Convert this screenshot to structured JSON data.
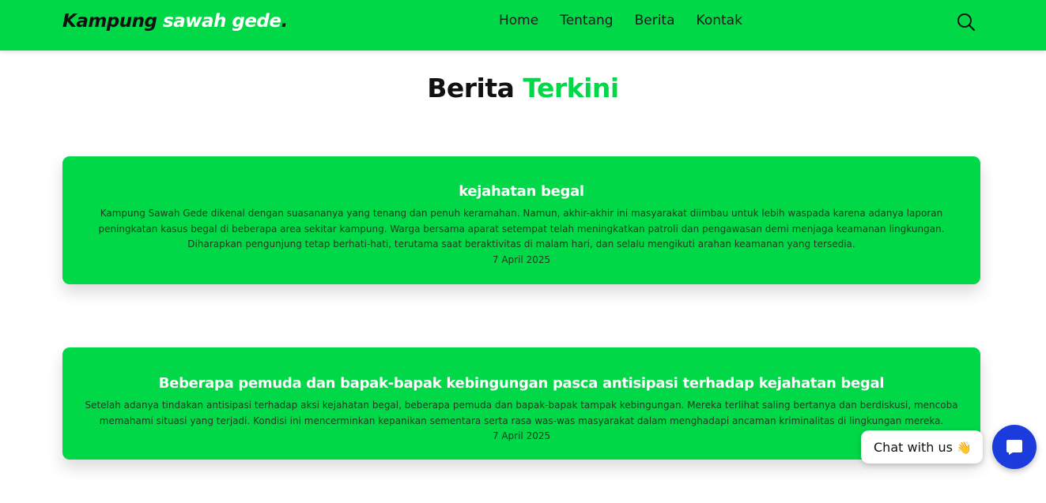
{
  "header": {
    "logo_part1": "Kampung ",
    "logo_part2": "sawah gede",
    "logo_part3": ".",
    "nav": [
      "Home",
      "Tentang",
      "Berita",
      "Kontak"
    ],
    "search_icon": "search-icon"
  },
  "main": {
    "title_part1": "Berita ",
    "title_part2": "Terkini",
    "articles": [
      {
        "title": "kejahatan begal",
        "body": "Kampung Sawah Gede dikenal dengan suasananya yang tenang dan penuh keramahan. Namun, akhir-akhir ini masyarakat diimbau untuk lebih waspada karena adanya laporan peningkatan kasus begal di beberapa area sekitar kampung. Warga bersama aparat setempat telah meningkatkan patroli dan pengawasan demi menjaga keamanan lingkungan. Diharapkan pengunjung tetap berhati-hati, terutama saat beraktivitas di malam hari, dan selalu mengikuti arahan keamanan yang tersedia.",
        "date": "7 April 2025"
      },
      {
        "title": "Beberapa pemuda dan bapak-bapak kebingungan pasca antisipasi terhadap kejahatan begal",
        "body": "Setelah adanya tindakan antisipasi terhadap aksi kejahatan begal, beberapa pemuda dan bapak-bapak tampak kebingungan. Mereka terlihat saling bertanya dan berdiskusi, mencoba memahami situasi yang terjadi. Kondisi ini mencerminkan kepanikan sementara serta rasa was-was masyarakat dalam menghadapi ancaman kriminalitas di lingkungan mereka.",
        "date": "7 April 2025"
      }
    ]
  },
  "chat": {
    "label": "Chat with us",
    "emoji": "👋",
    "icon": "chat-icon"
  },
  "colors": {
    "brand_green": "#00d847",
    "chat_blue": "#1c3bdc"
  }
}
